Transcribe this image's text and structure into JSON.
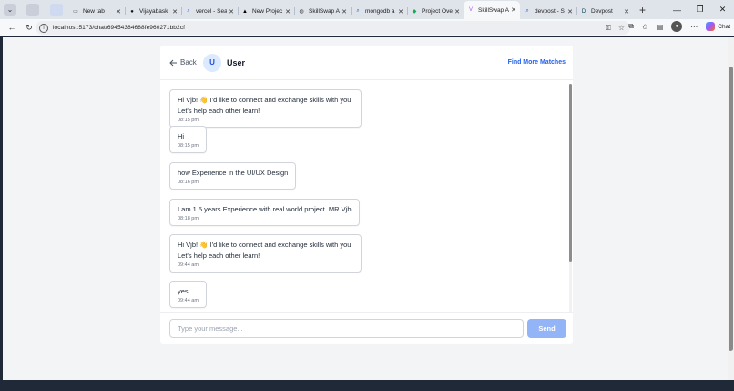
{
  "browser": {
    "tabs": [
      {
        "label": "New tab",
        "icon": "page-icon",
        "color": "#555555",
        "active": false
      },
      {
        "label": "Vijayabask",
        "icon": "github-icon",
        "color": "#111111",
        "active": false
      },
      {
        "label": "vercel - Sea",
        "icon": "search-icon",
        "color": "#2563eb",
        "active": false
      },
      {
        "label": "New Projec",
        "icon": "vercel-icon",
        "color": "#000000",
        "active": false
      },
      {
        "label": "SkillSwap A",
        "icon": "globe-icon",
        "color": "#444444",
        "active": false
      },
      {
        "label": "mongodb a",
        "icon": "search-icon",
        "color": "#2563eb",
        "active": false
      },
      {
        "label": "Project Ove",
        "icon": "mongodb-icon",
        "color": "#13aa52",
        "active": false
      },
      {
        "label": "SkillSwap A",
        "icon": "vite-icon",
        "color": "#a855f7",
        "active": true
      },
      {
        "label": "devpost - S",
        "icon": "search-icon",
        "color": "#2563eb",
        "active": false
      },
      {
        "label": "Devpost",
        "icon": "devpost-icon",
        "color": "#003e54",
        "active": false
      }
    ],
    "url": "localhost:5173/chat/69454384688fe960271bb2cf",
    "copilot_label": "Chat"
  },
  "chat": {
    "back_label": "Back",
    "avatar_initial": "U",
    "user_name": "User",
    "find_matches_label": "Find More Matches",
    "messages": [
      {
        "text": "Hi Vjb! 👋 I'd like to connect and exchange skills with you.\nLet's help each other learn!",
        "time": "08:15 pm"
      },
      {
        "text": "Hi",
        "time": "08:15 pm"
      },
      {
        "text": "how Experience in the UI/UX Design",
        "time": "08:16 pm"
      },
      {
        "text": "I am 1.5 years Experience with real world project. MR.Vjb",
        "time": "08:18 pm"
      },
      {
        "text": "Hi Vjb! 👋 I'd like to connect and exchange skills with you.\nLet's help each other learn!",
        "time": "09:44 am"
      },
      {
        "text": "yes",
        "time": "09:44 am"
      }
    ],
    "input_placeholder": "Type your message...",
    "send_label": "Send"
  }
}
